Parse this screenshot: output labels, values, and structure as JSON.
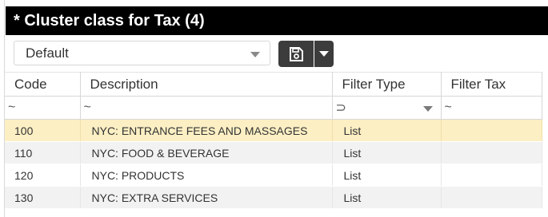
{
  "window": {
    "title": "* Cluster class for Tax (4)"
  },
  "toolbar": {
    "view_value": "Default"
  },
  "grid": {
    "columns": [
      "Code",
      "Description",
      "Filter Type",
      "Filter Tax"
    ],
    "filters": {
      "code": "~",
      "description": "~",
      "filter_type": "⊃",
      "filter_tax": "~"
    },
    "rows": [
      {
        "code": "100",
        "description": "NYC: ENTRANCE FEES AND MASSAGES",
        "filter_type": "List",
        "filter_tax": ""
      },
      {
        "code": "110",
        "description": "NYC: FOOD & BEVERAGE",
        "filter_type": "List",
        "filter_tax": ""
      },
      {
        "code": "120",
        "description": "NYC: PRODUCTS",
        "filter_type": "List",
        "filter_tax": ""
      },
      {
        "code": "130",
        "description": "NYC: EXTRA SERVICES",
        "filter_type": "List",
        "filter_tax": ""
      }
    ]
  },
  "colors": {
    "titlebar": "#000000",
    "selected_row": "#fcefc4",
    "alt_row": "#f2f2f2",
    "button": "#3c3c3c"
  },
  "icons": [
    "save-icon",
    "chevron-down-icon",
    "contains-filter-icon",
    "subset-filter-icon"
  ]
}
